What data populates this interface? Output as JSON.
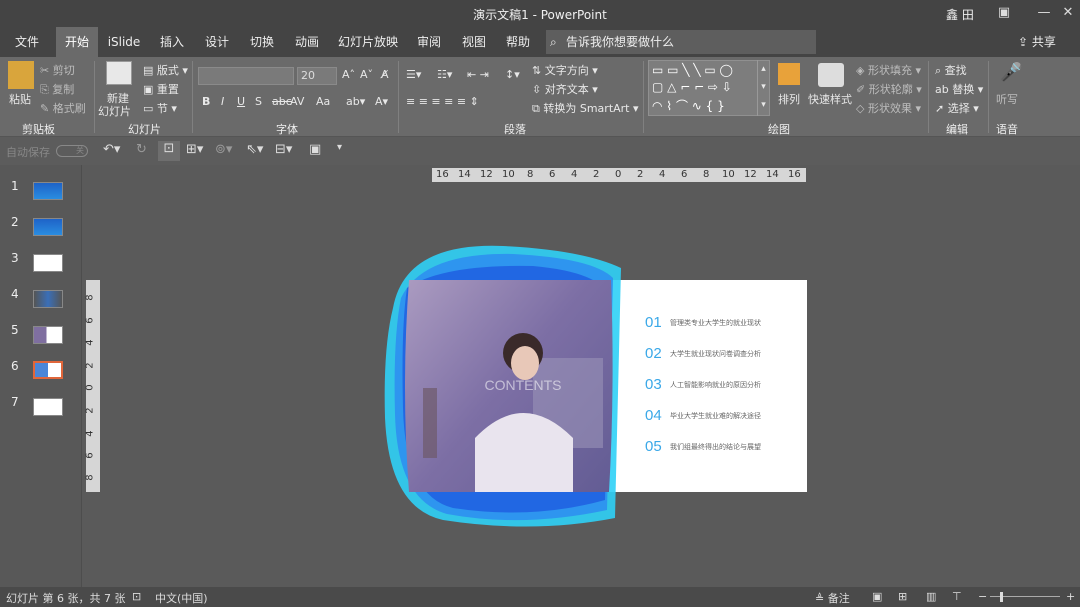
{
  "titlebar": {
    "title": "演示文稿1  -  PowerPoint",
    "user": "鑫 田",
    "minimize": "—",
    "restore": "❐",
    "close": "✕"
  },
  "tabs": [
    "文件",
    "开始",
    "iSlide",
    "插入",
    "设计",
    "切换",
    "动画",
    "幻灯片放映",
    "审阅",
    "视图",
    "帮助"
  ],
  "tellme": {
    "placeholder": "告诉我你想要做什么"
  },
  "share": "共享",
  "ribbon": {
    "clipboard": {
      "label": "剪贴板",
      "paste": "粘贴",
      "cut": "剪切",
      "copy": "复制",
      "format_painter": "格式刷"
    },
    "slides": {
      "label": "幻灯片",
      "new_slide_1": "新建",
      "new_slide_2": "幻灯片",
      "layout": "版式",
      "reset": "重置",
      "section": "节"
    },
    "font": {
      "label": "字体",
      "font_size": "20",
      "bold": "B",
      "italic": "I",
      "underline": "U",
      "shadow": "S",
      "spacing": "AV",
      "case": "Aa"
    },
    "paragraph": {
      "label": "段落",
      "text_direction": "文字方向",
      "align_text": "对齐文本",
      "smartart": "转换为 SmartArt"
    },
    "drawing": {
      "label": "绘图",
      "arrange": "排列",
      "quick_styles": "快速样式",
      "shape_fill": "形状填充",
      "shape_outline": "形状轮廓",
      "shape_effect": "形状效果"
    },
    "editing": {
      "label": "编辑",
      "find": "查找",
      "replace": "替换",
      "select": "选择"
    },
    "voice": {
      "label": "语音",
      "dictate": "听写"
    }
  },
  "qat": {
    "autosave": "自动保存",
    "off": "关"
  },
  "thumbs": [
    "1",
    "2",
    "3",
    "4",
    "5",
    "6",
    "7"
  ],
  "hruler": [
    "16",
    "14",
    "12",
    "10",
    "8",
    "6",
    "4",
    "2",
    "0",
    "2",
    "4",
    "6",
    "8",
    "10",
    "12",
    "14",
    "16"
  ],
  "vruler": [
    "8",
    "6",
    "4",
    "2",
    "0",
    "2",
    "4",
    "6",
    "8"
  ],
  "slide": {
    "photo_caption": "CONTENTS",
    "items": [
      {
        "num": "01",
        "text": "管理类专业大学生的就业现状"
      },
      {
        "num": "02",
        "text": "大学生就业现状问卷调查分析"
      },
      {
        "num": "03",
        "text": "人工智能影响就业的原因分析"
      },
      {
        "num": "04",
        "text": "毕业大学生就业难的解决途径"
      },
      {
        "num": "05",
        "text": "我们组最终得出的结论与展望"
      }
    ]
  },
  "status": {
    "slide_info": "幻灯片 第 6 张，共 7 张",
    "language": "中文(中国)",
    "notes": "备注"
  },
  "colors": {
    "accent_blue": "#3aa8e8",
    "selected_thumb": "#e0663a"
  }
}
